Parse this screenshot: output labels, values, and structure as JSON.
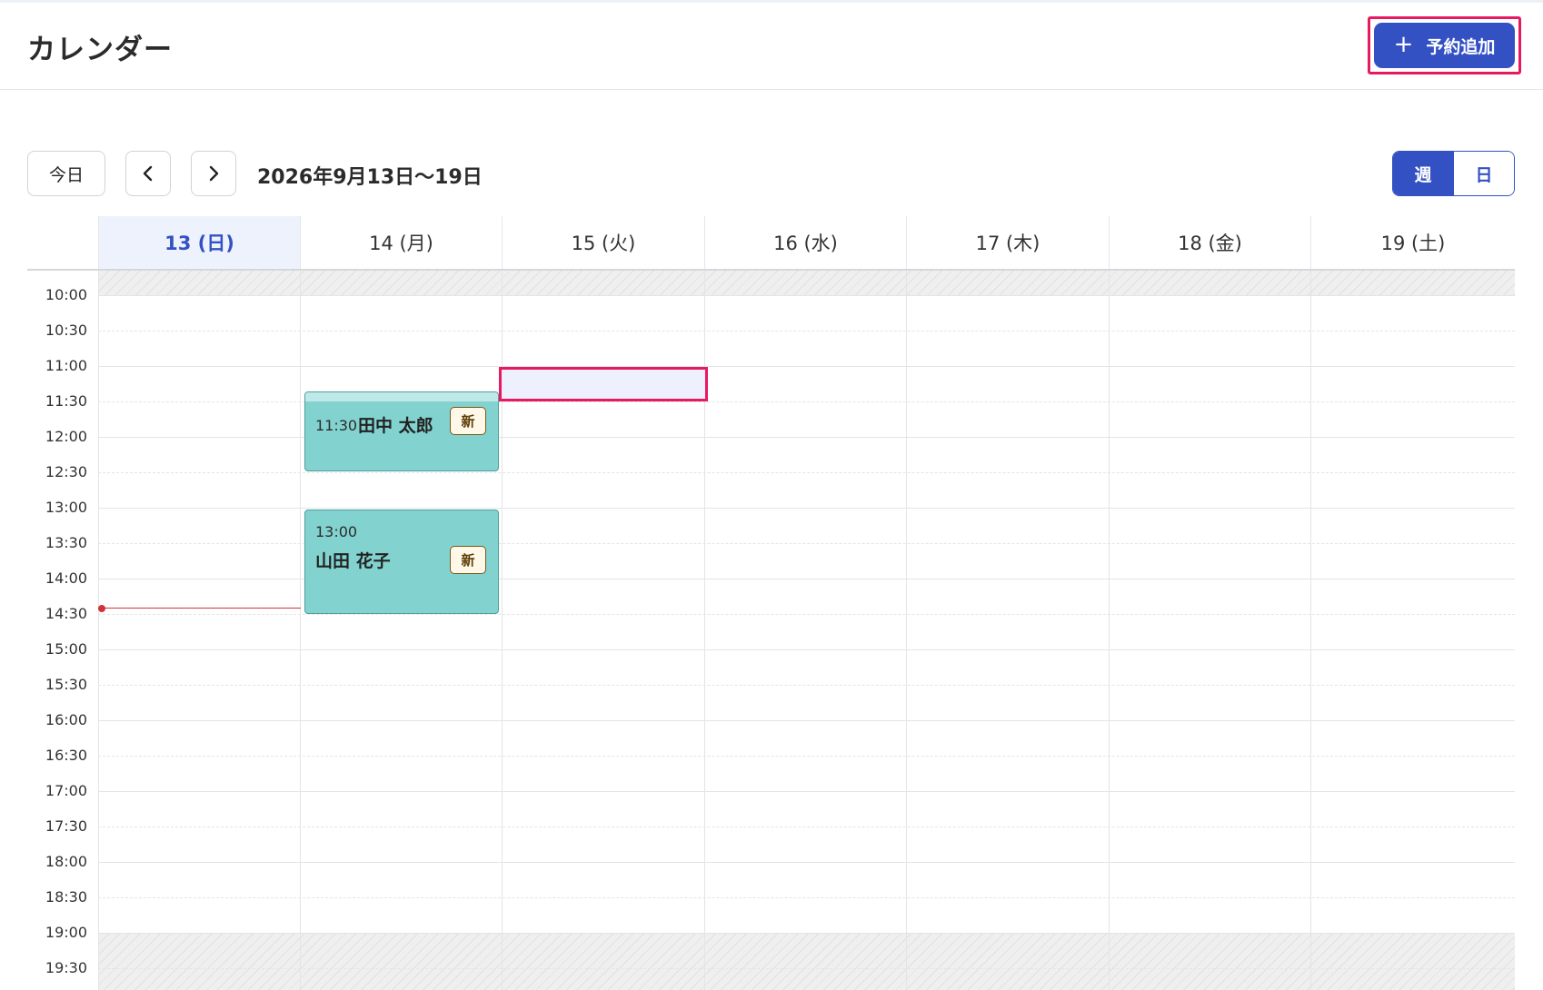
{
  "header": {
    "title": "カレンダー",
    "add_button_label": "予約追加"
  },
  "toolbar": {
    "today_label": "今日",
    "range_label": "2026年9月13日〜19日",
    "view_week_label": "週",
    "view_day_label": "日"
  },
  "days": [
    {
      "label": "13 (日)",
      "today": true
    },
    {
      "label": "14 (月)"
    },
    {
      "label": "15 (火)"
    },
    {
      "label": "16 (水)"
    },
    {
      "label": "17 (木)"
    },
    {
      "label": "18 (金)"
    },
    {
      "label": "19 (土)"
    }
  ],
  "time_slots": [
    "10:00",
    "10:30",
    "11:00",
    "11:30",
    "12:00",
    "12:30",
    "13:00",
    "13:30",
    "14:00",
    "14:30",
    "15:00",
    "15:30",
    "16:00",
    "16:30",
    "17:00",
    "17:30",
    "18:00",
    "18:30",
    "19:00",
    "19:30"
  ],
  "events": [
    {
      "time": "11:30",
      "name": "田中 太郎",
      "badge": "新"
    },
    {
      "time": "13:00",
      "name": "山田 花子",
      "badge": "新"
    }
  ],
  "colors": {
    "accent": "#3451c4",
    "highlight": "#e8195e",
    "event_bg": "#82d2d0",
    "now_line": "#d0343a"
  }
}
